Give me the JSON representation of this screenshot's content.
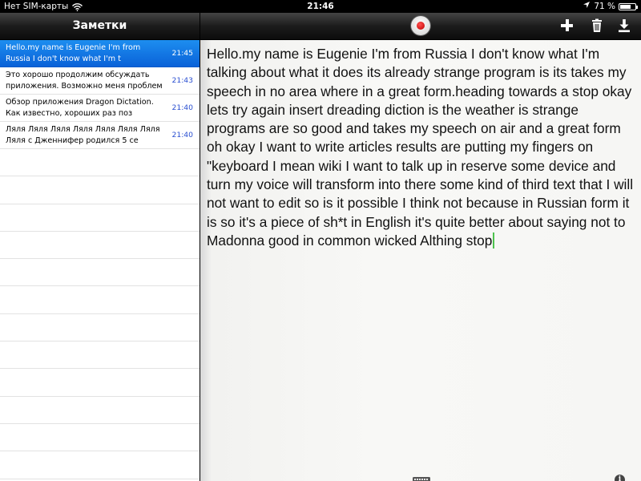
{
  "status_bar": {
    "carrier": "Нет SIM-карты",
    "time": "21:46",
    "battery": "71 %",
    "battery_level": 0.71
  },
  "sidebar": {
    "title": "Заметки",
    "notes": [
      {
        "line1": "Hello.my name is Eugenie I'm from",
        "line2": "Russia I don't know what I'm t",
        "time": "21:45",
        "selected": true
      },
      {
        "line1": "Это хорошо продолжим обсуждать",
        "line2": "приложения. Возможно меня проблем",
        "time": "21:43",
        "selected": false
      },
      {
        "line1": "Обзор приложения Dragon Dictation.",
        "line2": "Как известно, хороших раз поз",
        "time": "21:40",
        "selected": false
      },
      {
        "line1": "Ляля Ляля Ляля Ляля Ляля Ляля Ляля",
        "line2": "Ляля с Дженнифер родился 5 се",
        "time": "21:40",
        "selected": false
      }
    ]
  },
  "toolbar": {
    "record_icon": "record-icon",
    "add_icon": "plus-icon",
    "delete_icon": "trash-icon",
    "save_icon": "download-icon"
  },
  "editor": {
    "text": "Hello.my name is Eugenie I'm from Russia I don't know what I'm talking about what it does its already strange program is its takes my speech in no area where in a great form.heading towards a stop okay lets try again insert dreading diction is the weather is strange programs are so good and takes my speech on air and a great form oh okay I want to write articles results are putting my fingers on \"keyboard I mean wiki I want to talk up in reserve some device and turn my voice will transform into there some kind of third text that I will not want to edit so is it possible I think not because in Russian form it is so it's a piece of sh*t in English it's quite better about saying not to Madonna good in common wicked Althing stop"
  },
  "bottom_bar": {
    "keyboard_icon": "keyboard-icon",
    "info_label": "i"
  },
  "colors": {
    "selection": "#0a62d8",
    "time": "#2a4fd1",
    "record": "#c00000",
    "caret": "#4ec24e"
  }
}
